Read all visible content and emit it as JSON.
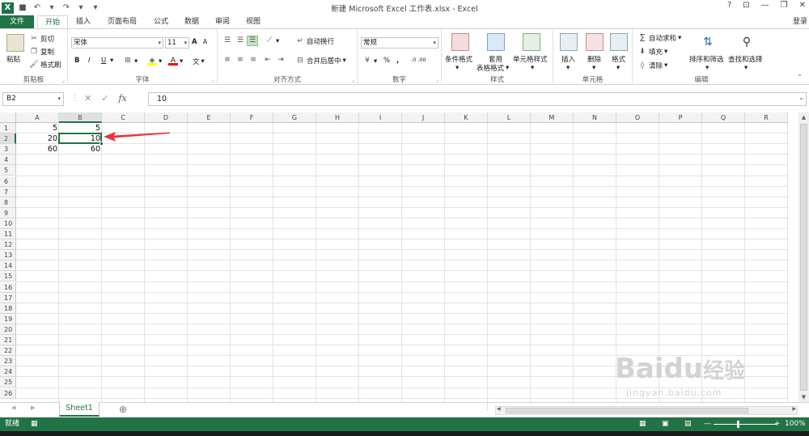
{
  "window": {
    "title": "新建 Microsoft Excel 工作表.xlsx - Excel",
    "controls": [
      "?",
      "⊡",
      "—",
      "❐",
      "✕"
    ]
  },
  "qat": {
    "logo": "X",
    "undo": "↶",
    "redo": "↷",
    "save": "💾",
    "customize": "▾"
  },
  "tabs": [
    {
      "label": "文件",
      "name": "tab-file"
    },
    {
      "label": "开始",
      "name": "tab-home"
    },
    {
      "label": "插入",
      "name": "tab-insert"
    },
    {
      "label": "页面布局",
      "name": "tab-page-layout"
    },
    {
      "label": "公式",
      "name": "tab-formulas"
    },
    {
      "label": "数据",
      "name": "tab-data"
    },
    {
      "label": "审阅",
      "name": "tab-review"
    },
    {
      "label": "视图",
      "name": "tab-view"
    }
  ],
  "active_tab": "开始",
  "login": "登录",
  "ribbon": {
    "clipboard": {
      "label": "剪贴板",
      "paste": "粘贴",
      "cut": "剪切",
      "copy": "复制",
      "format_painter": "格式刷"
    },
    "font": {
      "label": "字体",
      "font_name": "宋体",
      "font_size": "11",
      "bold": "B",
      "italic": "I",
      "underline": "U",
      "grow": "A",
      "shrink": "A",
      "font_color": "A",
      "phonetic": "文"
    },
    "alignment": {
      "label": "对齐方式",
      "wrap": "自动换行",
      "merge": "合并后居中"
    },
    "number": {
      "label": "数字",
      "format": "常规",
      "percent": "%",
      "comma": ",",
      "increase_decimal": ".0 .00",
      "decrease_decimal": ".00 .0"
    },
    "styles": {
      "label": "样式",
      "conditional": "条件格式",
      "table_format_1": "套用",
      "table_format_2": "表格格式",
      "cell_styles": "单元格样式"
    },
    "cells": {
      "label": "单元格",
      "insert": "插入",
      "delete": "删除",
      "format": "格式"
    },
    "editing": {
      "label": "编辑",
      "autosum": "自动求和",
      "fill": "填充",
      "clear": "清除",
      "sort_filter": "排序和筛选",
      "find_select": "查找和选择"
    }
  },
  "formula_bar": {
    "name_box": "B2",
    "cancel": "✕",
    "enter": "✓",
    "fx": "fx",
    "content": "10"
  },
  "columns": [
    "A",
    "B",
    "C",
    "D",
    "E",
    "F",
    "G",
    "H",
    "I",
    "J",
    "K",
    "L",
    "M",
    "N",
    "O",
    "P",
    "Q",
    "R"
  ],
  "rows": [
    "1",
    "2",
    "3",
    "4",
    "5",
    "6",
    "7",
    "8",
    "9",
    "10",
    "11",
    "12",
    "13",
    "14",
    "15",
    "16",
    "17",
    "18",
    "19",
    "20",
    "21",
    "22",
    "23",
    "24",
    "25",
    "26"
  ],
  "cells": {
    "A1": "5",
    "B1": "5",
    "A2": "20",
    "B2": "10",
    "A3": "60",
    "B3": "60"
  },
  "selected": {
    "cell": "B2",
    "column": "B",
    "row": "2"
  },
  "sheets": {
    "active": "Sheet1",
    "add": "⊕",
    "prev": "◀",
    "next": "▶"
  },
  "status": {
    "ready": "就绪",
    "zoom": "100%",
    "zoom_minus": "—",
    "zoom_plus": "+"
  },
  "watermark": {
    "brand": "Bai",
    "du": "du",
    "cn": "经验",
    "url": "jingyan.baidu.com"
  },
  "colors": {
    "excel_green": "#217346",
    "arrow_red": "#e8333a"
  }
}
